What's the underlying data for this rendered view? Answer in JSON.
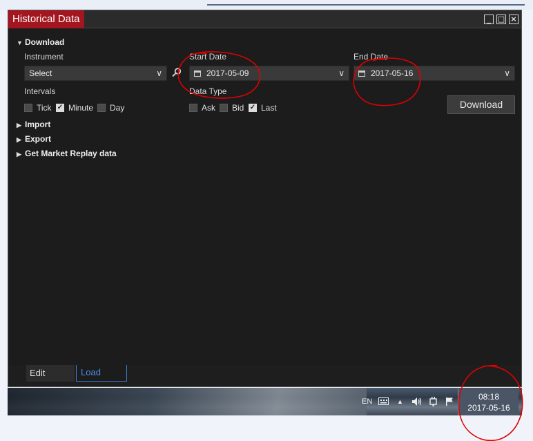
{
  "window": {
    "title": "Historical Data",
    "controls": {
      "minimize": "_",
      "maximize": "□",
      "close": "×"
    }
  },
  "sections": {
    "download": "Download",
    "import": "Import",
    "export": "Export",
    "replay": "Get Market Replay data"
  },
  "instrument": {
    "label": "Instrument",
    "value": "Select"
  },
  "start_date": {
    "label": "Start Date",
    "value": "2017-05-09"
  },
  "end_date": {
    "label": "End Date",
    "value": "2017-05-16"
  },
  "intervals": {
    "label": "Intervals",
    "options": [
      {
        "label": "Tick",
        "checked": false
      },
      {
        "label": "Minute",
        "checked": true
      },
      {
        "label": "Day",
        "checked": false
      }
    ]
  },
  "data_type": {
    "label": "Data Type",
    "options": [
      {
        "label": "Ask",
        "checked": false
      },
      {
        "label": "Bid",
        "checked": false
      },
      {
        "label": "Last",
        "checked": true
      }
    ]
  },
  "download_button": "Download",
  "tabs": {
    "edit": "Edit",
    "load": "Load"
  },
  "taskbar": {
    "language": "EN",
    "time": "08:18",
    "date": "2017-05-16"
  },
  "colors": {
    "title_tab": "#a4161f",
    "window_bg": "#1c1c1d",
    "annotation": "#e00000",
    "active_tab": "#4a90e2"
  },
  "icons": [
    "search-icon",
    "calendar-icon",
    "chevron-down-icon",
    "triangle-expanded-icon",
    "triangle-collapsed-icon",
    "keyboard-icon",
    "volume-icon",
    "power-icon",
    "flag-icon",
    "tray-arrow-icon"
  ]
}
